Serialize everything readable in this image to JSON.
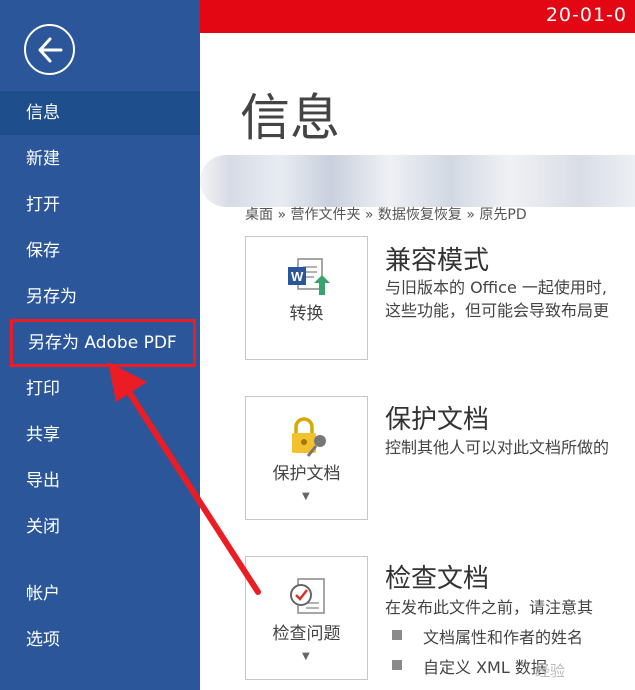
{
  "sidebar": {
    "items": [
      {
        "label": "信息"
      },
      {
        "label": "新建"
      },
      {
        "label": "打开"
      },
      {
        "label": "保存"
      },
      {
        "label": "另存为"
      },
      {
        "label": "另存为 Adobe PDF"
      },
      {
        "label": "打印"
      },
      {
        "label": "共享"
      },
      {
        "label": "导出"
      },
      {
        "label": "关闭"
      },
      {
        "label": "帐户"
      },
      {
        "label": "选项"
      }
    ]
  },
  "topbar": {
    "text": "20-01-0"
  },
  "main": {
    "title": "信息",
    "breadcrumb": "桌面 » 营作文件夹 » 数据恢复恢复 » 原先PD",
    "sections": [
      {
        "button_label": "转换",
        "title": "兼容模式",
        "desc": [
          "与旧版本的 Office 一起使用时,",
          "这些功能，但可能会导致布局更"
        ]
      },
      {
        "button_label": "保护文档",
        "title": "保护文档",
        "desc": [
          "控制其他人可以对此文档所做的"
        ]
      },
      {
        "button_label": "检查问题",
        "title": "检查文档",
        "desc": [
          "在发布此文件之前，请注意其"
        ],
        "bullets": [
          "文档属性和作者的姓名",
          "自定义 XML 数据"
        ]
      }
    ]
  },
  "watermark": "经验",
  "colors": {
    "sidebar": "#2b579a",
    "topbar": "#e30613",
    "highlight": "#ec1c24"
  }
}
